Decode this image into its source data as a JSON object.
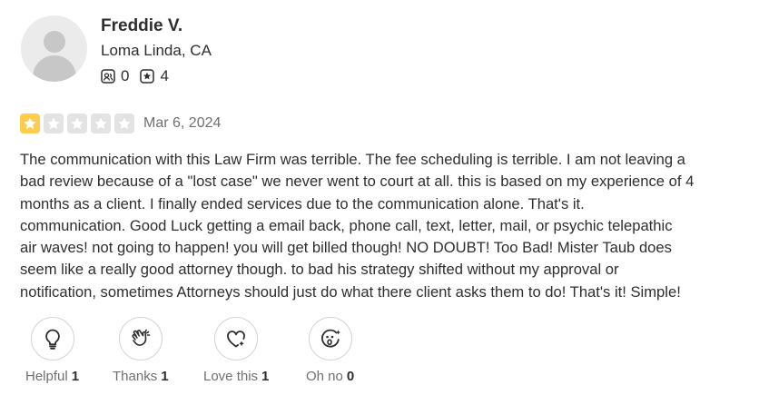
{
  "user": {
    "name": "Freddie V.",
    "location": "Loma Linda, CA",
    "friends_count": "0",
    "reviews_count": "4"
  },
  "review": {
    "rating": 1,
    "max_rating": 5,
    "date": "Mar 6, 2024",
    "lines": [
      "The communication with this Law Firm was terrible. The fee scheduling is terrible. I am not leaving a",
      "bad review because of a \"lost case\" we never went to court at all. this is based on my experience of 4",
      "months as a client. I finally ended services due to the communication alone. That's it.",
      "communication. Good Luck getting a email back, phone call, text, letter, mail, or psychic telepathic",
      "air waves! not going to happen! you will get billed though! NO DOUBT! Too Bad! Mister Taub does",
      "seem like a really good attorney though. to bad his strategy shifted without my approval or",
      "notification, sometimes Attorneys should just do what there client asks them to do! That's it! Simple!"
    ]
  },
  "colors": {
    "star_on": "#ffcc4b",
    "star_off": "#e3e3e3",
    "text": "#2d2e2f",
    "muted": "#6e7072"
  },
  "reactions": [
    {
      "label": "Helpful",
      "count": "1",
      "icon": "lightbulb-icon"
    },
    {
      "label": "Thanks",
      "count": "1",
      "icon": "clapping-hands-icon"
    },
    {
      "label": "Love this",
      "count": "1",
      "icon": "heart-sparkle-icon"
    },
    {
      "label": "Oh no",
      "count": "0",
      "icon": "surprised-face-icon"
    }
  ]
}
